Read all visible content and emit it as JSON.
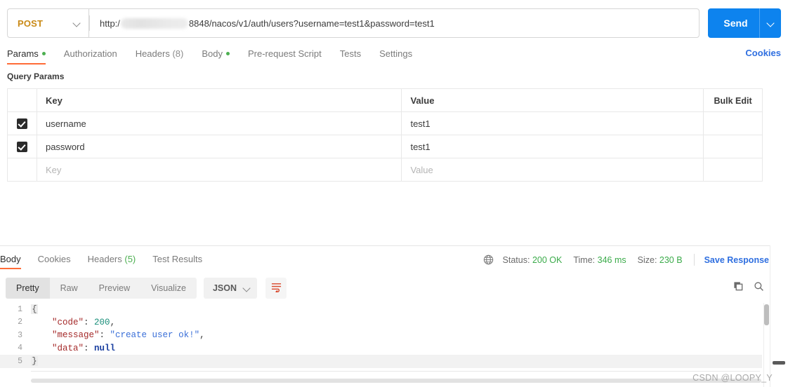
{
  "request": {
    "method": "POST",
    "method_caret_icon": "chevron-down-icon",
    "url_prefix": "http:/",
    "url_redacted": true,
    "url_suffix": "8848/nacos/v1/auth/users?username=test1&password=test1",
    "url_full_display": "http:/[redacted]8848/nacos/v1/auth/users?username=test1&password=test1",
    "send_label": "Send",
    "send_caret_icon": "chevron-down-icon",
    "send_color": "#0d83ee",
    "method_color": "#c98a17"
  },
  "request_tabs": {
    "items": [
      {
        "label": "Params",
        "active": true,
        "dot": true
      },
      {
        "label": "Authorization",
        "active": false,
        "dot": false
      },
      {
        "label": "Headers",
        "count": "(8)",
        "active": false,
        "dot": false
      },
      {
        "label": "Body",
        "active": false,
        "dot": true
      },
      {
        "label": "Pre-request Script",
        "active": false,
        "dot": false
      },
      {
        "label": "Tests",
        "active": false,
        "dot": false
      },
      {
        "label": "Settings",
        "active": false,
        "dot": false
      }
    ],
    "cookies_link": "Cookies",
    "accent": "#ff6c37",
    "link_color": "#2f6fe0"
  },
  "query_params": {
    "section_title": "Query Params",
    "columns": {
      "key": "Key",
      "value": "Value",
      "bulk_edit": "Bulk Edit"
    },
    "rows": [
      {
        "checked": true,
        "key": "username",
        "value": "test1",
        "placeholder": false
      },
      {
        "checked": true,
        "key": "password",
        "value": "test1",
        "placeholder": false
      },
      {
        "checked": false,
        "key": "Key",
        "value": "Value",
        "placeholder": true
      }
    ]
  },
  "response_tabs": {
    "items": [
      {
        "label": "Body",
        "active": true
      },
      {
        "label": "Cookies",
        "active": false
      },
      {
        "label": "Headers",
        "count": "(5)",
        "active": false
      },
      {
        "label": "Test Results",
        "active": false
      }
    ]
  },
  "response_status": {
    "globe_icon": "globe-icon",
    "status_label": "Status:",
    "status_value": "200 OK",
    "time_label": "Time:",
    "time_value": "346 ms",
    "size_label": "Size:",
    "size_value": "230 B",
    "save_response": "Save Response",
    "save_caret_icon": "chevron-down-icon",
    "ok_color": "#3bab4a"
  },
  "response_toolbar": {
    "view_modes": [
      {
        "label": "Pretty",
        "active": true
      },
      {
        "label": "Raw",
        "active": false
      },
      {
        "label": "Preview",
        "active": false
      },
      {
        "label": "Visualize",
        "active": false
      }
    ],
    "format": "JSON",
    "format_caret_icon": "chevron-down-icon",
    "wrap_icon": "wrap-lines-icon",
    "copy_icon": "copy-icon",
    "search_icon": "search-icon"
  },
  "response_body": {
    "language": "json",
    "lines": [
      {
        "n": "1",
        "tokens": [
          {
            "t": "{",
            "c": "punc"
          }
        ]
      },
      {
        "n": "2",
        "tokens": [
          {
            "t": "    ",
            "c": "punc"
          },
          {
            "t": "\"code\"",
            "c": "key"
          },
          {
            "t": ": ",
            "c": "punc"
          },
          {
            "t": "200",
            "c": "num"
          },
          {
            "t": ",",
            "c": "punc"
          }
        ]
      },
      {
        "n": "3",
        "tokens": [
          {
            "t": "    ",
            "c": "punc"
          },
          {
            "t": "\"message\"",
            "c": "key"
          },
          {
            "t": ": ",
            "c": "punc"
          },
          {
            "t": "\"create user ok!\"",
            "c": "str"
          },
          {
            "t": ",",
            "c": "punc"
          }
        ]
      },
      {
        "n": "4",
        "tokens": [
          {
            "t": "    ",
            "c": "punc"
          },
          {
            "t": "\"data\"",
            "c": "key"
          },
          {
            "t": ": ",
            "c": "punc"
          },
          {
            "t": "null",
            "c": "null"
          }
        ]
      },
      {
        "n": "5",
        "tokens": [
          {
            "t": "}",
            "c": "punc"
          }
        ]
      }
    ]
  },
  "watermark": {
    "text": "CSDN @LOOPY_Y"
  }
}
